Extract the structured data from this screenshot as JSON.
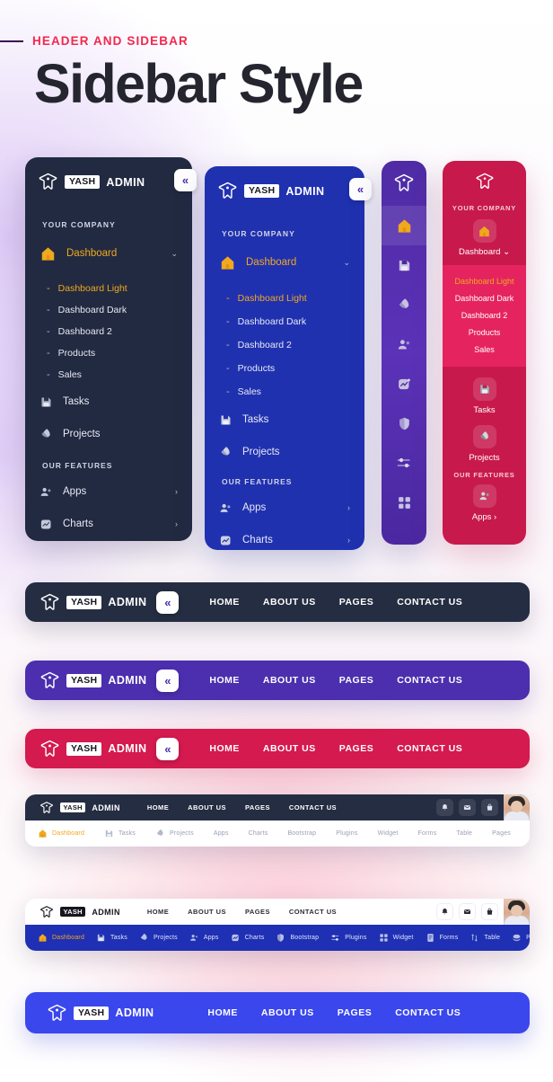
{
  "header_section": {
    "kicker": "HEADER AND SIDEBAR",
    "title": "Sidebar Style"
  },
  "brand": {
    "badge": "YASH",
    "admin": "ADMIN",
    "logo_icon": "yash-trident-logo-icon"
  },
  "toggle": {
    "glyph": "«",
    "name": "collapse-toggle"
  },
  "sidebar_dark": {
    "section_company": "YOUR COMPANY",
    "section_features": "OUR FEATURES",
    "dashboard": {
      "label": "Dashboard",
      "icon": "home-icon",
      "chevron": "⌄"
    },
    "sub_items": [
      {
        "label": "Dashboard Light",
        "active": true
      },
      {
        "label": "Dashboard Dark",
        "active": false
      },
      {
        "label": "Dashboard 2",
        "active": false
      },
      {
        "label": "Products",
        "active": false
      },
      {
        "label": "Sales",
        "active": false
      }
    ],
    "items": [
      {
        "label": "Tasks",
        "icon": "save-icon",
        "chevron": ""
      },
      {
        "label": "Projects",
        "icon": "rocket-icon",
        "chevron": ""
      }
    ],
    "feature_items": [
      {
        "label": "Apps",
        "icon": "users-icon",
        "chevron": "›"
      },
      {
        "label": "Charts",
        "icon": "chart-icon",
        "chevron": "›"
      }
    ]
  },
  "sidebar_icons_only": {
    "items": [
      {
        "icon": "home-icon",
        "name": "rail-dashboard",
        "active": true
      },
      {
        "icon": "save-icon",
        "name": "rail-tasks",
        "active": false
      },
      {
        "icon": "rocket-icon",
        "name": "rail-projects",
        "active": false
      },
      {
        "icon": "users-icon",
        "name": "rail-apps",
        "active": false
      },
      {
        "icon": "chart-icon",
        "name": "rail-charts",
        "active": false
      },
      {
        "icon": "shield-icon",
        "name": "rail-bootstrap",
        "active": false
      },
      {
        "icon": "sliders-icon",
        "name": "rail-plugins",
        "active": false
      },
      {
        "icon": "grid-icon",
        "name": "rail-widget",
        "active": false
      }
    ]
  },
  "sidebar_pink": {
    "section_company": "YOUR COMPANY",
    "section_features": "OUR FEATURES",
    "dashboard": {
      "label": "Dashboard",
      "icon": "home-icon",
      "chevron": "⌄"
    },
    "sub_items": [
      {
        "label": "Dashboard Light",
        "active": true
      },
      {
        "label": "Dashboard Dark",
        "active": false
      },
      {
        "label": "Dashboard 2",
        "active": false
      },
      {
        "label": "Products",
        "active": false
      },
      {
        "label": "Sales",
        "active": false
      }
    ],
    "items": [
      {
        "label": "Tasks",
        "icon": "save-icon"
      },
      {
        "label": "Projects",
        "icon": "rocket-icon"
      }
    ],
    "feature_items": [
      {
        "label": "Apps ›",
        "icon": "users-icon"
      }
    ]
  },
  "nav_links": [
    "HOME",
    "ABOUT US",
    "PAGES",
    "CONTACT US"
  ],
  "headers": [
    {
      "name": "header-dark",
      "color": "#252d42"
    },
    {
      "name": "header-purple",
      "color": "#4b2fae"
    },
    {
      "name": "header-crimson",
      "color": "#d41a4e"
    },
    {
      "name": "header-dark-with-submenu",
      "color": "#252d42"
    },
    {
      "name": "header-light-with-blue-submenu",
      "color": "#ffffff"
    },
    {
      "name": "header-blue",
      "color": "#3a47ec"
    }
  ],
  "tray_icons": [
    {
      "name": "bell-icon"
    },
    {
      "name": "envelope-icon"
    },
    {
      "name": "bag-icon"
    }
  ],
  "avatar": {
    "name": "user-avatar"
  },
  "submenu": [
    {
      "label": "Dashboard",
      "icon": "home-icon",
      "active": true
    },
    {
      "label": "Tasks",
      "icon": "save-icon",
      "active": false
    },
    {
      "label": "Projects",
      "icon": "rocket-icon",
      "active": false
    },
    {
      "label": "Apps",
      "icon": "users-icon",
      "active": false
    },
    {
      "label": "Charts",
      "icon": "chart-icon",
      "active": false
    },
    {
      "label": "Bootstrap",
      "icon": "shield-icon",
      "active": false
    },
    {
      "label": "Plugins",
      "icon": "sliders-icon",
      "active": false
    },
    {
      "label": "Widget",
      "icon": "grid-icon",
      "active": false
    },
    {
      "label": "Forms",
      "icon": "form-icon",
      "active": false
    },
    {
      "label": "Table",
      "icon": "table-icon",
      "active": false
    },
    {
      "label": "Pages",
      "icon": "pages-icon",
      "active": false
    }
  ],
  "colors": {
    "accent_red": "#f2274c",
    "accent_yellow": "#f0a81f",
    "dark": "#252d42",
    "purple": "#4b2fae",
    "blue": "#2031b0",
    "bright_blue": "#3a47ec",
    "crimson": "#d41a4e"
  }
}
